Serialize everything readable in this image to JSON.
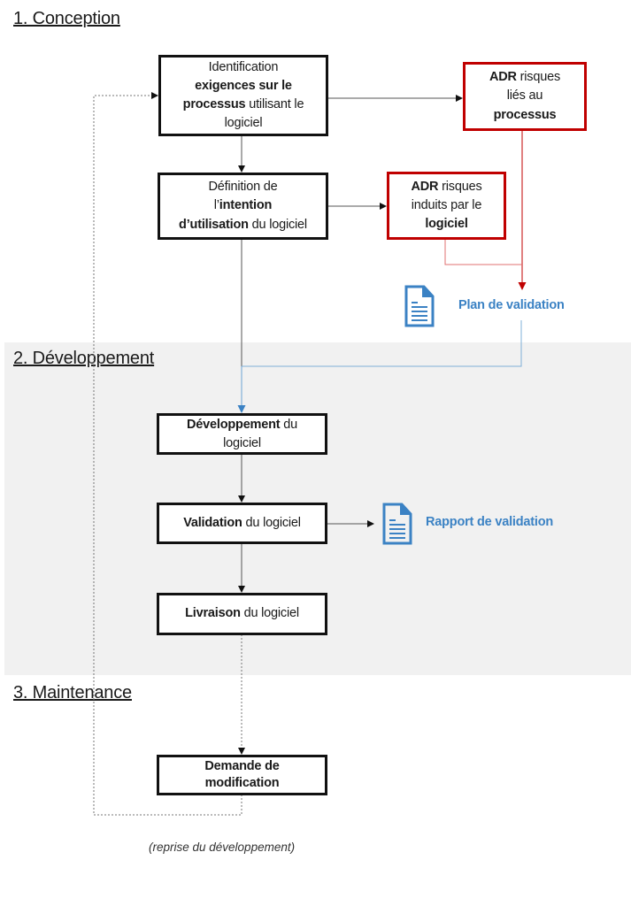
{
  "sections": {
    "conception": "1. Conception",
    "developpement": "2. Développement",
    "maintenance": "3. Maintenance"
  },
  "boxes": {
    "identification": {
      "l1": "Identification",
      "b1": "exigences sur le",
      "b2": "processus",
      "t2": " utilisant le",
      "l4": "logiciel"
    },
    "definition": {
      "l1": "Définition de",
      "t2": "l’",
      "b2": "intention",
      "b3": "d’utilisation",
      "t3": " du logiciel"
    },
    "adr_processus": {
      "b1": "ADR",
      "t1": " risques",
      "l2": "liés au",
      "b3": "processus"
    },
    "adr_logiciel": {
      "b1": "ADR",
      "t1": " risques",
      "l2": "induits par le",
      "b3": "logiciel"
    },
    "developpement": {
      "b1": "Développement",
      "t1": " du",
      "l2": "logiciel"
    },
    "validation": {
      "b1": "Validation",
      "t1": " du logiciel"
    },
    "livraison": {
      "b1": "Livraison",
      "t1": " du logiciel"
    },
    "demande": {
      "b1": "Demande de",
      "b2": "modification"
    }
  },
  "documents": {
    "plan": "Plan de validation",
    "rapport": "Rapport de validation"
  },
  "note": "(reprise du développement)",
  "colors": {
    "red": "#c00000",
    "blue": "#3b82c4",
    "band": "#f1f1f1"
  }
}
